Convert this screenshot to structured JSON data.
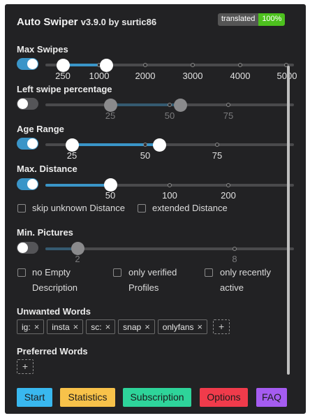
{
  "header": {
    "title": "Auto Swiper",
    "version": "v3.9.0 by surtic86",
    "badge_label": "translated",
    "badge_value": "100%"
  },
  "max_swipes": {
    "label": "Max Swipes",
    "enabled": true,
    "ticks": [
      "250",
      "1000",
      "2000",
      "3000",
      "4000",
      "5000"
    ],
    "range": [
      250,
      1000
    ]
  },
  "left_swipe": {
    "label": "Left swipe percentage",
    "enabled": false,
    "ticks": [
      "25",
      "50",
      "75"
    ],
    "range": [
      25,
      55
    ]
  },
  "age_range": {
    "label": "Age Range",
    "enabled": true,
    "ticks": [
      "25",
      "50",
      "75"
    ],
    "range": [
      25,
      55
    ]
  },
  "max_distance": {
    "label": "Max. Distance",
    "enabled": true,
    "ticks": [
      "50",
      "100",
      "200"
    ],
    "value": 50,
    "options": {
      "skip_unknown": "skip unknown Distance",
      "extended": "extended Distance"
    }
  },
  "min_pictures": {
    "label": "Min. Pictures",
    "enabled": false,
    "ticks": [
      "2",
      "8"
    ],
    "value": 2,
    "options": {
      "no_empty_1": "no Empty",
      "no_empty_2": "Description",
      "verified_1": "only verified",
      "verified_2": "Profiles",
      "recent_1": "only recently",
      "recent_2": "active"
    }
  },
  "unwanted_words": {
    "label": "Unwanted Words",
    "items": [
      "ig:",
      "insta",
      "sc:",
      "snap",
      "onlyfans"
    ],
    "add_label": "+"
  },
  "preferred_words": {
    "label": "Preferred Words",
    "items": [],
    "add_label": "+"
  },
  "buttons": {
    "start": "Start",
    "statistics": "Statistics",
    "subscription": "Subscription",
    "options": "Options",
    "faq": "FAQ"
  },
  "colors": {
    "accent": "#3a95c8",
    "start": "#39b8ef",
    "statistics": "#f8c24a",
    "subscription": "#2ed49a",
    "options": "#f03b4b",
    "faq": "#a55cf0",
    "badge_value": "#4dc11e"
  },
  "icons": {
    "chip_remove": "×"
  }
}
